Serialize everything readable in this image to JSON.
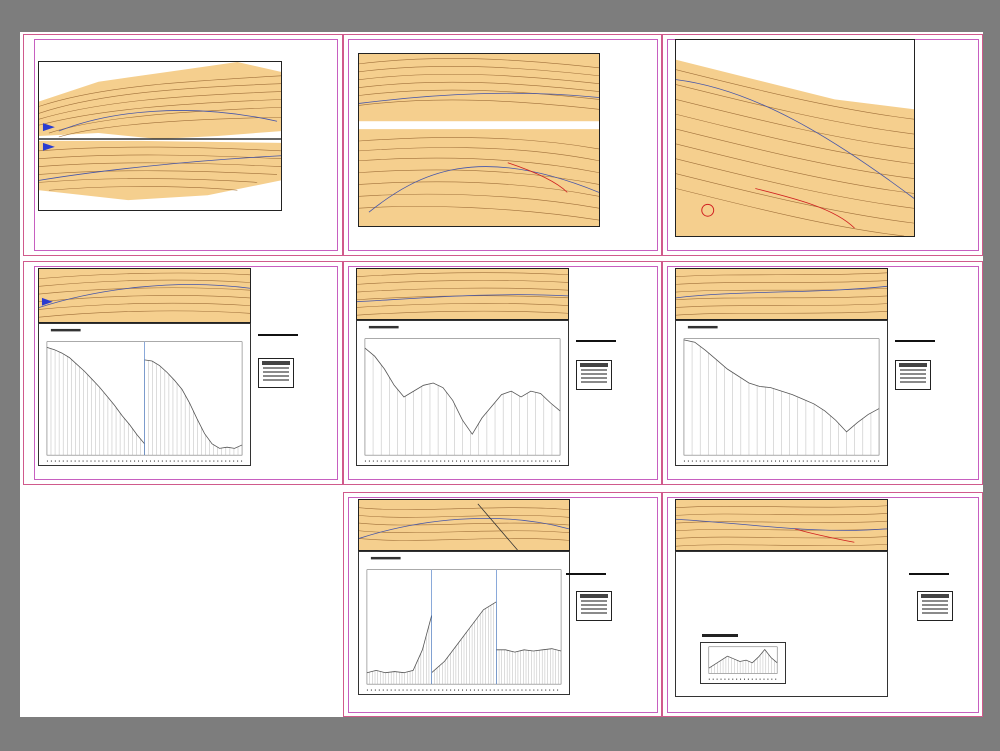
{
  "viewer": {
    "background_color": "#7d7d7d",
    "paper_color": "#ffffff",
    "sheet_border_color": "#d05a8c"
  },
  "drawing": {
    "map_fill": "#f5cf8e",
    "contour_color": "#a0703a",
    "road_color": "#4455aa",
    "annotation_color": "#d02020"
  },
  "sheets": [
    {
      "id": "sheet-1",
      "content": "plan"
    },
    {
      "id": "sheet-2",
      "content": "plan"
    },
    {
      "id": "sheet-3",
      "content": "plan"
    },
    {
      "id": "sheet-4",
      "content": "plan-and-profile"
    },
    {
      "id": "sheet-5",
      "content": "plan-and-profile"
    },
    {
      "id": "sheet-6",
      "content": "plan-and-profile"
    },
    {
      "id": "sheet-7",
      "content": "plan-and-profile"
    },
    {
      "id": "sheet-8",
      "content": "plan-and-profile"
    }
  ],
  "profiles": {
    "p4a": [
      0.95,
      0.93,
      0.9,
      0.86,
      0.8,
      0.74,
      0.67,
      0.6,
      0.52,
      0.44,
      0.35,
      0.27,
      0.18,
      0.1
    ],
    "p4b": [
      0.84,
      0.83,
      0.79,
      0.73,
      0.66,
      0.58,
      0.46,
      0.32,
      0.19,
      0.1,
      0.06,
      0.07,
      0.06,
      0.09
    ],
    "p5": [
      0.92,
      0.85,
      0.74,
      0.6,
      0.5,
      0.55,
      0.6,
      0.62,
      0.58,
      0.47,
      0.3,
      0.18,
      0.32,
      0.42,
      0.52,
      0.55,
      0.5,
      0.55,
      0.53,
      0.45,
      0.38
    ],
    "p6": [
      0.99,
      0.97,
      0.9,
      0.82,
      0.74,
      0.68,
      0.62,
      0.59,
      0.58,
      0.55,
      0.52,
      0.48,
      0.44,
      0.38,
      0.3,
      0.2,
      0.28,
      0.35,
      0.4
    ],
    "p7a": [
      0.1,
      0.12,
      0.1,
      0.11,
      0.1,
      0.12,
      0.3,
      0.6
    ],
    "p7b": [
      0.1,
      0.2,
      0.35,
      0.5,
      0.65,
      0.72
    ],
    "p7c": [
      0.3,
      0.3,
      0.28,
      0.3,
      0.29,
      0.3,
      0.31,
      0.29
    ],
    "p8": [
      0.2,
      0.35,
      0.5,
      0.65,
      0.55,
      0.45,
      0.5,
      0.4,
      0.62,
      0.9,
      0.6,
      0.4
    ]
  }
}
